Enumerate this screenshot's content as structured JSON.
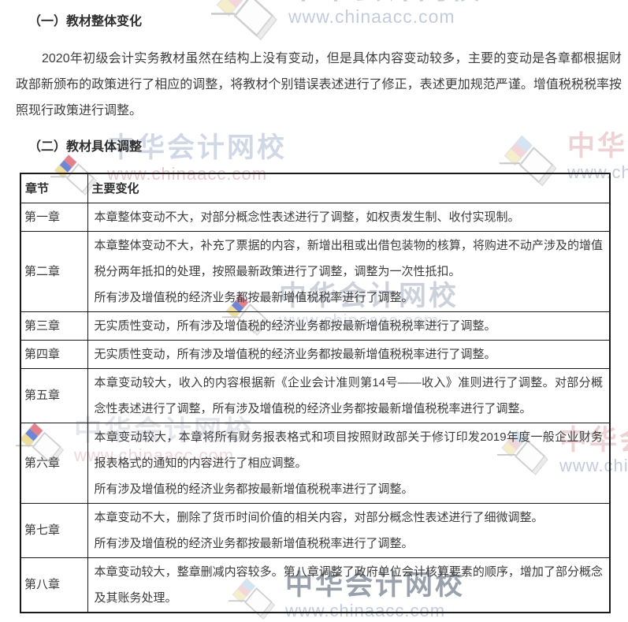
{
  "colors": {
    "text": "#3b3b3b",
    "table_border": "#1a1a1a",
    "watermark_text": "#b2bcd0"
  },
  "watermark": {
    "name": "中华会计网校",
    "url": "www.chinaacc.com",
    "logo": "chinaacc-two-books-logo"
  },
  "sections": {
    "section1_title": "（一）教材整体变化",
    "intro_paragraph": "2020年初级会计实务教材虽然在结构上没有变动，但是具体内容变动较多，主要的变动是各章都根据财政部新颁布的政策进行了相应的调整，将教材个别错误表述进行了修正，表述更加规范严谨。增值税税税率按照现行政策进行调整。",
    "section2_title": "（二）教材具体调整"
  },
  "table": {
    "headers": [
      "章节",
      "主要变化"
    ],
    "rows": [
      {
        "chapter": "第一章",
        "changes": [
          "本章整体变动不大，对部分概念性表述进行了调整，如权责发生制、收付实现制。"
        ]
      },
      {
        "chapter": "第二章",
        "changes": [
          "本章整体变动不大，补充了票据的内容，新增出租或出借包装物的核算，将购进不动产涉及的增值税分两年抵扣的处理，按照最新政策进行了调整，调整为一次性抵扣。",
          "所有涉及增值税的经济业务都按最新增值税税率进行了调整。"
        ]
      },
      {
        "chapter": "第三章",
        "changes": [
          "无实质性变动，所有涉及增值税的经济业务都按最新增值税税率进行了调整。"
        ]
      },
      {
        "chapter": "第四章",
        "changes": [
          "无实质性变动，所有涉及增值税的经济业务都按最新增值税税率进行了调整。"
        ]
      },
      {
        "chapter": "第五章",
        "changes": [
          "本章变动较大，收入的内容根据新《企业会计准则第14号——收入》准则进行了调整。对部分概念性表述进行了调整，所有涉及增值税的经济业务都按最新增值税税率进行了调整。"
        ]
      },
      {
        "chapter": "第六章",
        "changes": [
          "本章变动较大，本章将所有财务报表格式和项目按照财政部关于修订印发2019年度一般企业财务报表格式的通知的内容进行了相应调整。",
          "所有涉及增值税的经济业务都按最新增值税税率进行了调整。"
        ]
      },
      {
        "chapter": "第七章",
        "changes": [
          "本章变动不大，删除了货币时间价值的相关内容，对部分概念性表述进行了细微调整。",
          "所有涉及增值税的经济业务都按最新增值税税率进行了调整。"
        ]
      },
      {
        "chapter": "第八章",
        "changes": [
          "本章变动较大，整章删减内容较多。第八章调整了政府单位会计核算要素的顺序，增加了部分概念及其账务处理。"
        ]
      }
    ]
  }
}
